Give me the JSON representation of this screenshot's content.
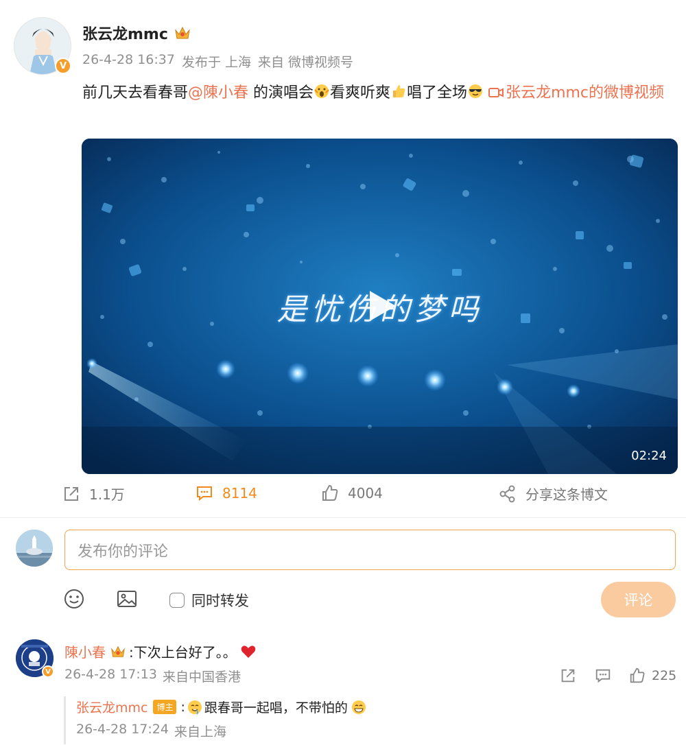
{
  "post": {
    "author": "张云龙mmc",
    "time": "26-4-28 16:37",
    "published_at": "发布于 上海",
    "source": "来自 微博视频号",
    "text_1": "前几天去看春哥",
    "mention": "@陳小春",
    "text_2": " 的演唱会",
    "text_3": "看爽听爽",
    "text_4": "唱了全场",
    "video_link": "张云龙mmc的微博视频",
    "video": {
      "caption": "是忧伤的梦吗",
      "duration": "02:24"
    }
  },
  "actions": {
    "repost_count": "1.1万",
    "comment_count": "8114",
    "like_count": "4004",
    "share_label": "分享这条博文"
  },
  "composer": {
    "placeholder": "发布你的评论",
    "also_repost_label": "同时转发",
    "submit_label": "评论"
  },
  "comments": [
    {
      "name": "陳小春",
      "text": ":下次上台好了。。",
      "time": "26-4-28 17:13",
      "location": "来自中国香港",
      "like_count": "225",
      "reply": {
        "name": "张云龙mmc",
        "badge": "博主",
        "text_prefix": ":",
        "text": "跟春哥一起唱，不带怕的",
        "time": "26-4-28 17:24",
        "location": "来自上海"
      }
    }
  ],
  "colors": {
    "link": "#eb7350",
    "accent": "#f08a1a",
    "input_border": "#f3a44e",
    "submit_bg": "#fbcba0",
    "vip_badge": "#f79d2a"
  },
  "icons": [
    "repost-icon",
    "comment-icon",
    "like-icon",
    "share-icon",
    "emoji-icon",
    "image-icon",
    "play-icon",
    "video-link-icon",
    "crown-icon"
  ]
}
